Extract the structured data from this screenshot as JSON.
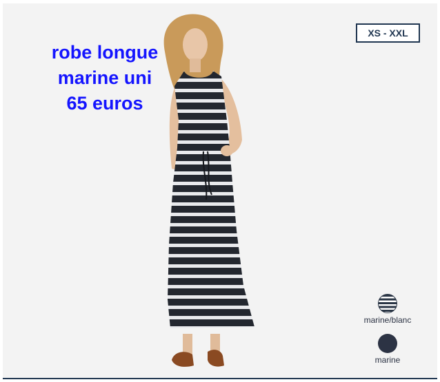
{
  "headline": {
    "line1": "robe longue",
    "line2": "marine uni",
    "line3": "65 euros"
  },
  "size_range": "XS - XXL",
  "colors": {
    "headline": "#1414ff",
    "badge_border": "#1f3550",
    "dress_dark": "#23272f",
    "dress_light": "#e9eaed"
  },
  "swatches": [
    {
      "label": "marine/blanc",
      "pattern": "stripes"
    },
    {
      "label": "marine",
      "pattern": "solid"
    }
  ]
}
